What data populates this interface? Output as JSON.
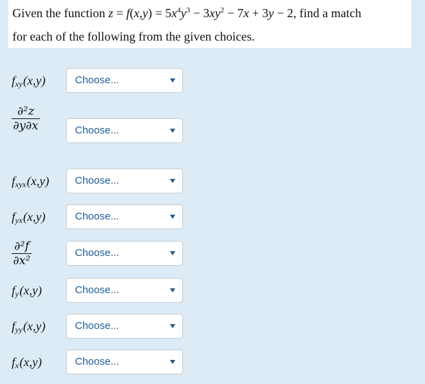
{
  "question": {
    "line1_prefix": "Given the function ",
    "line1_suffix": " find a match",
    "line2": "for each of the following from the given choices."
  },
  "select_placeholder": "Choose...",
  "items": [
    {
      "kind": "func",
      "fn": "f",
      "sub": "xy",
      "args": "(x,y)"
    },
    {
      "kind": "frac",
      "num": "∂²z",
      "den": "∂y∂x"
    },
    {
      "kind": "func",
      "fn": "f",
      "sub": "xyx",
      "args": "(x,y)"
    },
    {
      "kind": "func",
      "fn": "f",
      "sub": "yx",
      "args": "(x,y)"
    },
    {
      "kind": "frac",
      "num": "∂²f",
      "den": "∂x²"
    },
    {
      "kind": "func",
      "fn": "f",
      "sub": "y",
      "args": "(x,y)"
    },
    {
      "kind": "func",
      "fn": "f",
      "sub": "yy",
      "args": "(x,y)"
    },
    {
      "kind": "func",
      "fn": "f",
      "sub": "x",
      "args": "(x,y)"
    }
  ]
}
